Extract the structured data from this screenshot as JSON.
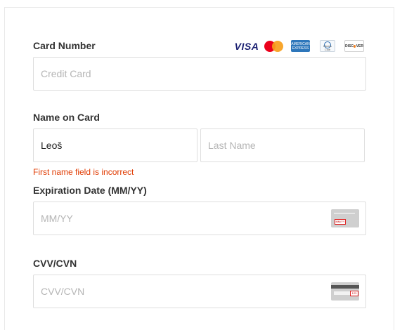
{
  "card_number": {
    "label": "Card Number",
    "placeholder": "Credit Card",
    "brands": {
      "visa": "VISA",
      "mastercard": "mastercard-logo",
      "amex": "AMERICAN EXPRESS",
      "diners": "Diners Club",
      "discover": "DISCOVER"
    }
  },
  "name_on_card": {
    "label": "Name on Card",
    "first_name_value": "Leoš",
    "last_name_placeholder": "Last Name",
    "error": "First name field is incorrect"
  },
  "expiration": {
    "label": "Expiration Date (MM/YY)",
    "placeholder": "MM/YY",
    "icon_hint": "MM/YY"
  },
  "cvv": {
    "label": "CVV/CVN",
    "placeholder": "CVV/CVN",
    "icon_hint": "123"
  },
  "colors": {
    "error": "#e03a00",
    "border": "#dedede",
    "placeholder": "#b5b5b5"
  }
}
